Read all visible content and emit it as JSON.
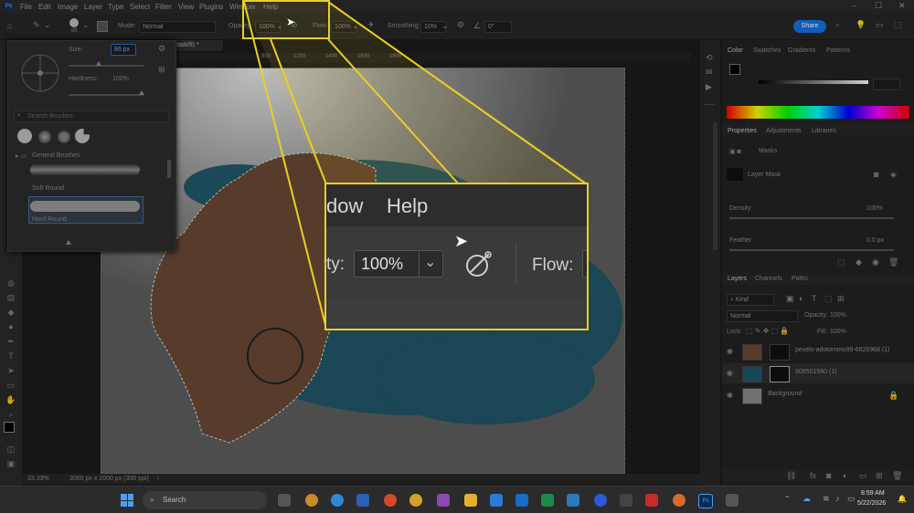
{
  "menubar": {
    "app_icon": "Ps",
    "items": [
      "File",
      "Edit",
      "Image",
      "Layer",
      "Type",
      "Select",
      "Filter",
      "View",
      "Plugins",
      "Window",
      "Help"
    ]
  },
  "options": {
    "size_value": "86",
    "mode_label": "Mode:",
    "mode_value": "Normal",
    "opacity_label": "Opacity:",
    "opacity_value": "100%",
    "flow_label": "Flow:",
    "flow_value": "100%",
    "smoothing_label": "Smoothing:",
    "smoothing_value": "10%",
    "angle_value": "0°",
    "share_label": "Share"
  },
  "document": {
    "tab_title": "er Mask/8) *",
    "ruler_marks": [
      "800",
      "1000",
      "1200",
      "1400",
      "1600",
      "1800"
    ]
  },
  "brush_popup": {
    "size_label": "Size:",
    "size_value": "86 px",
    "hardness_label": "Hardness:",
    "hardness_value": "100%",
    "search_placeholder": "Search Brushes",
    "folder_label": "General Brushes",
    "brush1": "Soft Round",
    "brush2": "Hard Round"
  },
  "panels": {
    "color_tabs": [
      "Color",
      "Swatches",
      "Gradients",
      "Patterns"
    ],
    "properties_tabs": [
      "Properties",
      "Adjustments",
      "Libraries"
    ],
    "masks_label": "Masks",
    "layer_mask_label": "Layer Mask",
    "density_label": "Density:",
    "density_value": "100%",
    "feather_label": "Feather:",
    "feather_value": "0.0 px",
    "layers_tabs": [
      "Layers",
      "Channels",
      "Paths"
    ],
    "kind_label": "Kind",
    "blend_value": "Normal",
    "opacity_label": "Opacity:",
    "opacity_value": "100%",
    "lock_label": "Lock:",
    "fill_label": "Fill:",
    "fill_value": "100%",
    "layers": [
      "pexels-adotommo99-6626968 (1)",
      "908501560 (1)",
      "Background"
    ]
  },
  "status": {
    "zoom": "33.33%",
    "doc_size": "3000 px x 2000 px (300 ppi)"
  },
  "taskbar": {
    "search_placeholder": "Search",
    "time": "8:59 AM",
    "date": "5/22/2026"
  },
  "callout": {
    "menu_fragment": "dow",
    "help_label": "Help",
    "opacity_fragment": "ty:",
    "opacity_value": "100%",
    "flow_label": "Flow:"
  }
}
